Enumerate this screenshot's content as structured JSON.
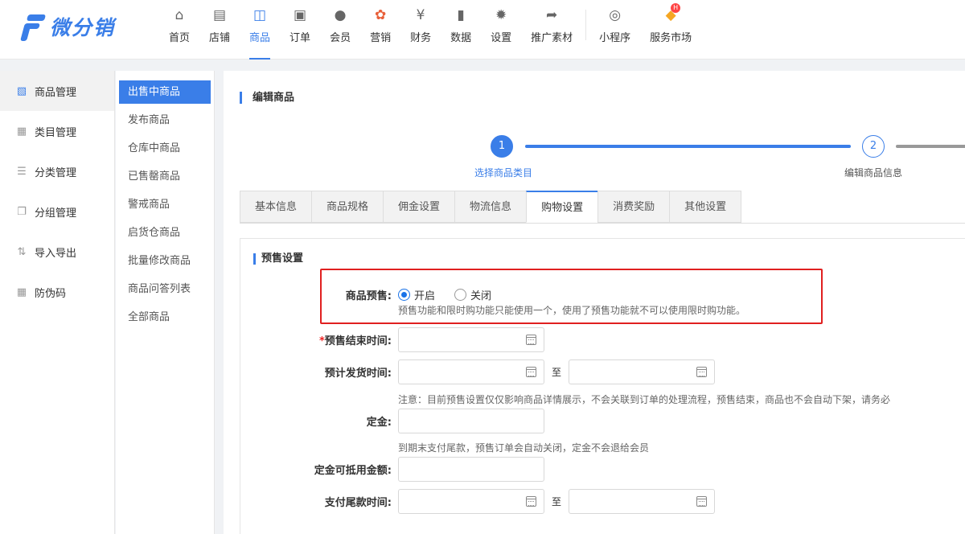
{
  "header": {
    "brand": "微分销",
    "nav": [
      {
        "label": "首页",
        "icon": "home-icon",
        "glyph": "⌂"
      },
      {
        "label": "店铺",
        "icon": "store-icon",
        "glyph": "▤"
      },
      {
        "label": "商品",
        "icon": "shopping-bag-icon",
        "glyph": "◫"
      },
      {
        "label": "订单",
        "icon": "clipboard-icon",
        "glyph": "▣"
      },
      {
        "label": "会员",
        "icon": "users-icon",
        "glyph": "●"
      },
      {
        "label": "营销",
        "icon": "flower-icon",
        "glyph": "✿"
      },
      {
        "label": "财务",
        "icon": "yen-coin-icon",
        "glyph": "¥"
      },
      {
        "label": "数据",
        "icon": "bar-chart-icon",
        "glyph": "▮"
      },
      {
        "label": "设置",
        "icon": "gear-icon",
        "glyph": "✹"
      },
      {
        "label": "推广素材",
        "icon": "share-arrow-icon",
        "glyph": "➦"
      },
      {
        "label": "小程序",
        "icon": "mini-program-icon",
        "glyph": "◎"
      },
      {
        "label": "服务市场",
        "icon": "diamond-icon",
        "glyph": "◆",
        "badge": "H"
      }
    ]
  },
  "sidebar": {
    "items": [
      {
        "label": "商品管理",
        "icon": "product-manage-icon",
        "glyph": "▧"
      },
      {
        "label": "类目管理",
        "icon": "category-grid-icon",
        "glyph": "▦"
      },
      {
        "label": "分类管理",
        "icon": "list-icon",
        "glyph": "☰"
      },
      {
        "label": "分组管理",
        "icon": "group-icon",
        "glyph": "❐"
      },
      {
        "label": "导入导出",
        "icon": "import-export-icon",
        "glyph": "⇅"
      },
      {
        "label": "防伪码",
        "icon": "anti-fake-icon",
        "glyph": "▦"
      }
    ]
  },
  "subnav": {
    "items": [
      "出售中商品",
      "发布商品",
      "仓库中商品",
      "已售罄商品",
      "警戒商品",
      "启货仓商品",
      "批量修改商品",
      "商品问答列表",
      "全部商品"
    ]
  },
  "main": {
    "title": "编辑商品",
    "steps": [
      {
        "num": "1",
        "label": "选择商品类目"
      },
      {
        "num": "2",
        "label": "编辑商品信息"
      }
    ],
    "tabs": [
      "基本信息",
      "商品规格",
      "佣金设置",
      "物流信息",
      "购物设置",
      "消费奖励",
      "其他设置"
    ],
    "section_title": "预售设置",
    "presale": {
      "label": "商品预售:",
      "opt_on": "开启",
      "opt_off": "关闭",
      "hint": "预售功能和限时购功能只能使用一个，使用了预售功能就不可以使用限时购功能。"
    },
    "end_time": {
      "req": "*",
      "label": "预售结束时间:"
    },
    "ship_time": {
      "label": "预计发货时间:",
      "to": "至",
      "hint": "注意：目前预售设置仅仅影响商品详情展示，不会关联到订单的处理流程，预售结束，商品也不会自动下架，请务必"
    },
    "deposit": {
      "label": "定金:",
      "hint": "到期末支付尾款，预售订单会自动关闭，定金不会退给会员"
    },
    "deposit_deduct": {
      "label": "定金可抵用金额:"
    },
    "final_pay": {
      "label": "支付尾款时间:",
      "to": "至"
    }
  },
  "colors": {
    "accent": "#3a7ee8",
    "highlight_box": "#e02020"
  }
}
